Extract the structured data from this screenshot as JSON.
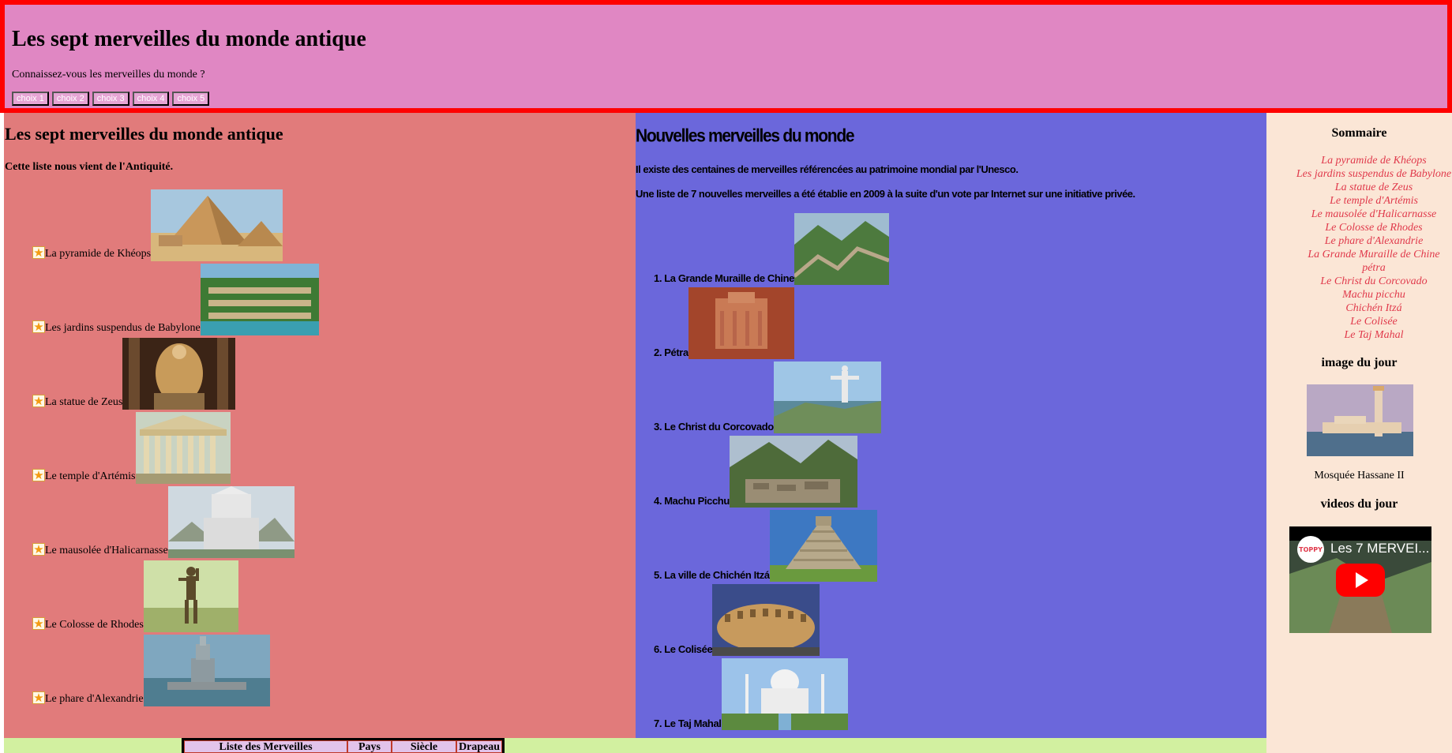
{
  "header": {
    "title": "Les sept merveilles du monde antique",
    "subtitle": "Connaissez-vous les merveilles du monde ?",
    "buttons": [
      "choix 1",
      "choix 2",
      "choix 3",
      "choix 4",
      "choix 5"
    ]
  },
  "left": {
    "title": "Les sept merveilles du monde antique",
    "intro": "Cette liste nous vient de l'Antiquité.",
    "items": [
      {
        "label": "La pyramide de Khéops",
        "image": "pyramid-image"
      },
      {
        "label": "Les jardins suspendus de Babylone",
        "image": "hanging-gardens-image"
      },
      {
        "label": "La statue de Zeus",
        "image": "zeus-statue-image"
      },
      {
        "label": "Le temple d'Artémis",
        "image": "artemis-temple-image"
      },
      {
        "label": "Le mausolée d'Halicarnasse",
        "image": "mausoleum-image"
      },
      {
        "label": "Le Colosse de Rhodes",
        "image": "colossus-image"
      },
      {
        "label": "Le phare d'Alexandrie",
        "image": "lighthouse-image"
      }
    ]
  },
  "middle": {
    "title": "Nouvelles merveilles du monde",
    "p1_text": "Il existe des centaines de merveilles référencées au ",
    "p1_strong": "patrimoine mondial par l'Unesco",
    "p1_end": ".",
    "p2": "Une liste de 7 nouvelles merveilles a été établie en 2009 à la suite d'un vote par Internet sur une initiative privée.",
    "items": [
      {
        "label": "1. La Grande Muraille de Chine",
        "image": "great-wall-image"
      },
      {
        "label": "2. Pétra",
        "image": "petra-image"
      },
      {
        "label": "3. Le Christ du Corcovado",
        "image": "christ-redeemer-image"
      },
      {
        "label": "4. Machu Picchu",
        "image": "machu-picchu-image"
      },
      {
        "label": "5. La ville de Chichén Itzá",
        "image": "chichen-itza-image"
      },
      {
        "label": "6. Le Colisée",
        "image": "colosseum-image"
      },
      {
        "label": "7. Le Taj Mahal",
        "image": "taj-mahal-image"
      }
    ]
  },
  "sidebar": {
    "summary_title": "Sommaire",
    "links": [
      "La pyramide de Khéops",
      "Les jardins suspendus de Babylone",
      "La statue de Zeus",
      "Le temple d'Artémis",
      "Le mausolée d'Halicarnasse",
      "Le Colosse de Rhodes",
      "Le phare d'Alexandrie",
      "La Grande Muraille de Chine",
      "pétra",
      "Le Christ du Corcovado",
      "Machu picchu",
      "Chichén Itzá",
      "Le Colisée",
      "Le Taj Mahal"
    ],
    "image_title": "image du jour",
    "image_caption": "Mosquée Hassane II",
    "videos_title": "videos du jour",
    "video_title": "Les 7 MERVEI...",
    "channel_badge": "TOPPY"
  },
  "footer": {
    "table_headers": [
      "Liste des Merveilles",
      "Pays",
      "Siècle",
      "Drapeau"
    ]
  },
  "colors": {
    "header_bg": "#e087c3",
    "header_border": "#ff0000",
    "left_bg": "#e17b7b",
    "middle_bg": "#6b67db",
    "sidebar_bg": "#fbe6d6",
    "footer_bg": "#d2f0a0",
    "link": "#e0394b"
  }
}
